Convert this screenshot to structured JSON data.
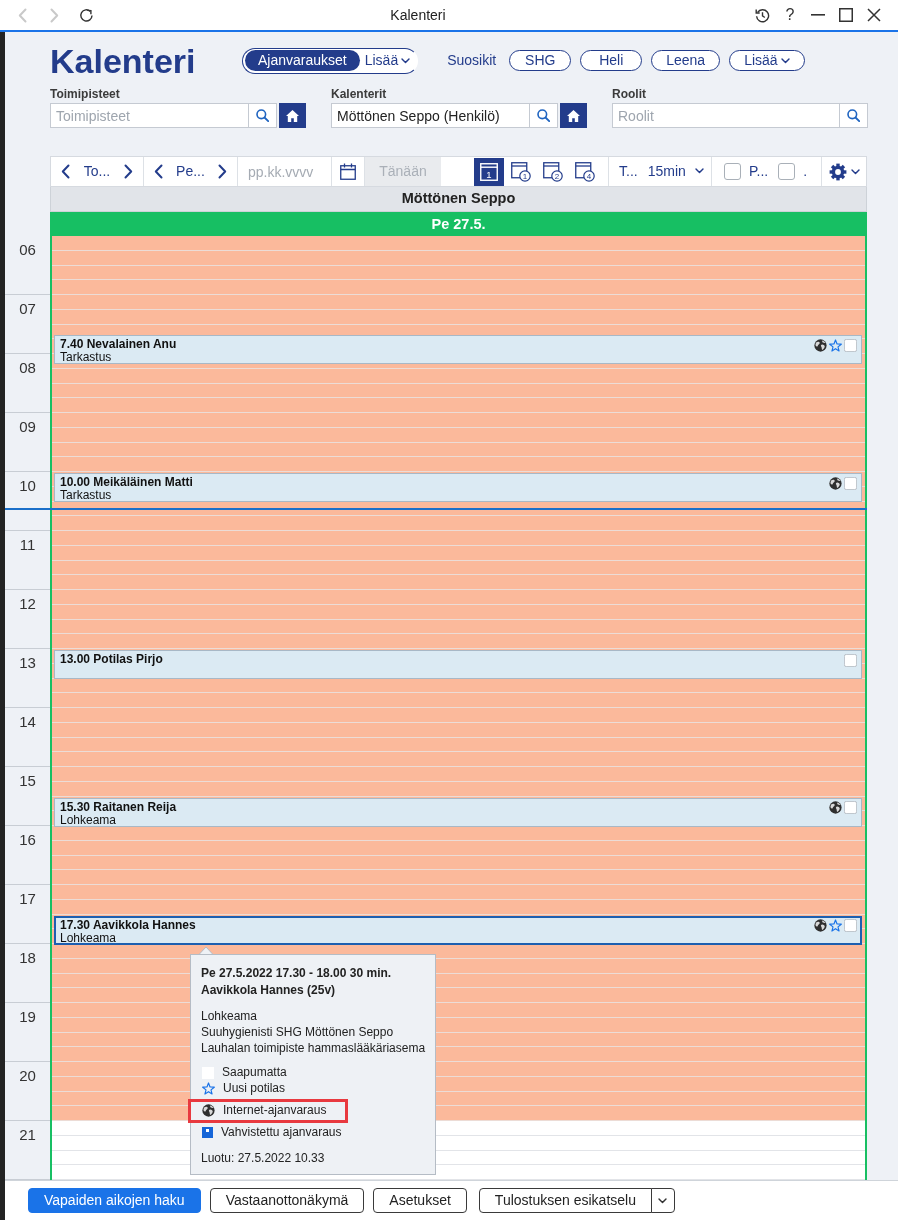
{
  "window": {
    "title": "Kalenteri",
    "back_disabled": true,
    "forward_disabled": true,
    "help": "?"
  },
  "header": {
    "title": "Kalenteri",
    "mode_switch": [
      {
        "label": "Ajanvaraukset",
        "kind": "option",
        "selected": true
      },
      {
        "label": "Lisää",
        "kind": "dropdown",
        "selected": false
      }
    ],
    "favorites_label": "Suosikit",
    "favorites": [
      {
        "label": "SHG",
        "kind": "option"
      },
      {
        "label": "Heli",
        "kind": "option"
      },
      {
        "label": "Leena",
        "kind": "option"
      },
      {
        "label": "Lisää",
        "kind": "dropdown"
      }
    ]
  },
  "filters": [
    {
      "label": "Toimipisteet",
      "placeholder": "Toimipisteet",
      "home_button": true
    },
    {
      "label": "Kalenterit",
      "value": "Möttönen Seppo (Henkilö)",
      "home_button": true
    },
    {
      "label": "Roolit",
      "placeholder": "Roolit",
      "home_button": false
    }
  ],
  "toolbar": {
    "steppers": [
      {
        "label": "To..."
      },
      {
        "label": "Pe..."
      }
    ],
    "date_field": {
      "placeholder": "pp.kk.vvvv"
    },
    "today_button": {
      "label": "Tänään",
      "disabled": true
    },
    "views": [
      {
        "kind": "day",
        "number": "1",
        "selected": true
      },
      {
        "kind": "weeks",
        "number": "1",
        "selected": false
      },
      {
        "kind": "weeks",
        "number": "2",
        "selected": false
      },
      {
        "kind": "weeks",
        "number": "4",
        "selected": false
      }
    ],
    "slot_label": "T...",
    "slot_length": "15min",
    "options": [
      {
        "label": "P...",
        "checked": false
      },
      {
        "label": ".",
        "checked": false
      }
    ]
  },
  "calendar": {
    "resource": "Möttönen Seppo",
    "day": "Pe 27.5.",
    "hours": [
      {
        "label": "06",
        "open": true,
        "now": false
      },
      {
        "label": "07",
        "open": true,
        "now": false
      },
      {
        "label": "08",
        "open": true,
        "now": false
      },
      {
        "label": "09",
        "open": true,
        "now": false
      },
      {
        "label": "10",
        "open": true,
        "now": true
      },
      {
        "label": "11",
        "open": true,
        "now": false
      },
      {
        "label": "12",
        "open": true,
        "now": false
      },
      {
        "label": "13",
        "open": true,
        "now": false
      },
      {
        "label": "14",
        "open": true,
        "now": false
      },
      {
        "label": "15",
        "open": true,
        "now": false
      },
      {
        "label": "16",
        "open": true,
        "now": false
      },
      {
        "label": "17",
        "open": true,
        "now": false
      },
      {
        "label": "18",
        "open": true,
        "now": false
      },
      {
        "label": "19",
        "open": true,
        "now": false
      },
      {
        "label": "20",
        "open": true,
        "now": false
      },
      {
        "label": "21",
        "open": false,
        "now": false
      }
    ],
    "appointments": [
      {
        "time": "7.40",
        "name": "Nevalainen Anu",
        "reason": "Tarkastus",
        "internet": true,
        "new_patient": true,
        "arrived": false,
        "selected": false
      },
      {
        "time": "10.00",
        "name": "Meikäläinen Matti",
        "reason": "Tarkastus",
        "internet": true,
        "new_patient": false,
        "arrived": false,
        "selected": false
      },
      {
        "time": "13.00",
        "name": "Potilas Pirjo",
        "internet": false,
        "new_patient": false,
        "arrived": false,
        "selected": false
      },
      {
        "time": "15.30",
        "name": "Raitanen Reija",
        "reason": "Lohkeama",
        "internet": true,
        "new_patient": false,
        "arrived": false,
        "selected": false
      },
      {
        "time": "17.30",
        "name": "Aavikkola Hannes",
        "reason": "Lohkeama",
        "internet": true,
        "new_patient": true,
        "arrived": false,
        "selected": true
      }
    ]
  },
  "tooltip": {
    "title": "Pe 27.5.2022 17.30 - 18.00 30 min.",
    "patient": "Aavikkola Hannes (25v)",
    "details": [
      "Lohkeama",
      "Suuhygienisti SHG Möttönen Seppo",
      "Lauhalan toimipiste hammaslääkäriasema"
    ],
    "legend": [
      {
        "kind": "not_arrived",
        "label": "Saapumatta",
        "highlighted": false
      },
      {
        "kind": "new_patient",
        "label": "Uusi potilas",
        "highlighted": false
      },
      {
        "kind": "internet",
        "label": "Internet-ajanvaraus",
        "highlighted": true
      },
      {
        "kind": "confirmed",
        "label": "Vahvistettu ajanvaraus",
        "highlighted": false
      }
    ],
    "created": "Luotu: 27.5.2022 10.33"
  },
  "footer": {
    "buttons": [
      {
        "label": "Vapaiden aikojen haku",
        "kind": "primary"
      },
      {
        "label": "Vastaanottonäkymä",
        "kind": "outline"
      },
      {
        "label": "Asetukset",
        "kind": "outline"
      },
      {
        "label": "Tulostuksen esikatselu",
        "kind": "split"
      }
    ]
  }
}
